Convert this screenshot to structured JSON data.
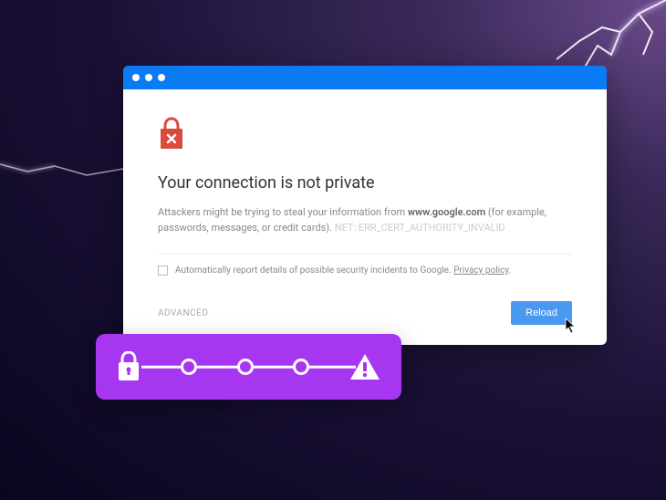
{
  "heading": "Your connection is not private",
  "body_prefix": "Attackers might be trying to steal your information from ",
  "domain": "www.google.com",
  "body_suffix": " (for example, passwords, messages, or credit cards). ",
  "error_code": "NET::ERR_CERT_AUTHORITY_INVALID",
  "checkbox_label": "Automatically report details of possible security incidents to Google. ",
  "privacy_link": "Privacy policy",
  "advanced_label": "ADVANCED",
  "reload_label": "Reload"
}
